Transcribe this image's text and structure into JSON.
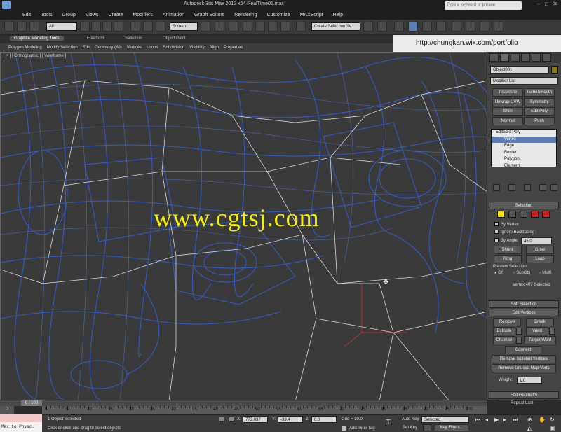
{
  "window": {
    "title": "Autodesk 3ds Max  2012 x64      RealTime01.max"
  },
  "menu": [
    "Edit",
    "Tools",
    "Group",
    "Views",
    "Create",
    "Modifiers",
    "Animation",
    "Graph Editors",
    "Rendering",
    "Customize",
    "MAXScript",
    "Help"
  ],
  "search": {
    "placeholder": "Type a keyword or phrase"
  },
  "toolbar": {
    "selection_filter": "All",
    "coordinate_system": "Screen",
    "named_selection": "Create Selection Se"
  },
  "ribbon": {
    "tabs": [
      "Graphite Modeling Tools",
      "Freeform",
      "Selection",
      "Object Paint"
    ],
    "panels": [
      "Polygon Modeling",
      "Modify Selection",
      "Edit",
      "Geometry (All)",
      "Vertices",
      "Loops",
      "Subdivision",
      "Visibility",
      "Align",
      "Properties"
    ]
  },
  "overlay_url": "http://chungkan.wix.com/portfolio",
  "viewport": {
    "label": "[ + ] [ Orthographic ] [ Wireframe ]",
    "watermark": "www.cgtsj.com",
    "wire_color": "#2f5fd6"
  },
  "command_panel": {
    "object_name": "Object001",
    "modifier_list": "Modifier List",
    "modifier_buttons": [
      "Tessellate",
      "TurboSmooth",
      "Unwrap UVW",
      "Symmetry",
      "Shell",
      "Edit Poly",
      "Normal",
      "Push"
    ],
    "stack": {
      "root": "Editable Poly",
      "items": [
        "Vertex",
        "Edge",
        "Border",
        "Polygon",
        "Element"
      ],
      "selected": "Vertex"
    },
    "selection_rollout": {
      "title": "Selection",
      "by_vertex": "By Vertex",
      "ignore_backfacing": "Ignore Backfacing",
      "by_angle": "By Angle:",
      "angle_value": "45.0",
      "shrink": "Shrink",
      "grow": "Grow",
      "ring": "Ring",
      "loop": "Loop",
      "preview_label": "Preview Selection",
      "preview_options": [
        "Off",
        "SubObj",
        "Multi"
      ],
      "status": "Vertex 407 Selected"
    },
    "soft_selection": "Soft Selection",
    "edit_vertices": {
      "title": "Edit Vertices",
      "remove": "Remove",
      "break": "Break",
      "extrude": "Extrude",
      "weld": "Weld",
      "chamfer": "Chamfer",
      "target_weld": "Target Weld",
      "connect": "Connect",
      "remove_isolated": "Remove Isolated Vertices",
      "remove_unused": "Remove Unused Map Verts",
      "weight_label": "Weight:",
      "weight_value": "1.0"
    },
    "edit_geometry": {
      "title": "Edit Geometry",
      "repeat_last": "Repeat Last"
    }
  },
  "timeline": {
    "frame_display": "0 / 100",
    "ticks": [
      "0",
      "5",
      "10",
      "15",
      "20",
      "25",
      "30",
      "35",
      "40",
      "45",
      "50",
      "55",
      "60",
      "65",
      "70",
      "75",
      "80",
      "85",
      "90",
      "95",
      "100"
    ]
  },
  "status": {
    "maxscript": "Max to Physc.",
    "selected": "1 Object Selected",
    "prompt": "Click or click-and-drag to select objects",
    "x_label": "X:",
    "x_value": "773.037",
    "y_label": "Y:",
    "y_value": "-39.4",
    "z_label": "Z:",
    "z_value": "0.0",
    "grid": "Grid = 10.0",
    "add_time_tag": "Add Time Tag",
    "auto_key": "Auto Key",
    "set_key": "Set Key",
    "key_mode": "Selected",
    "key_filters": "Key Filters..."
  }
}
